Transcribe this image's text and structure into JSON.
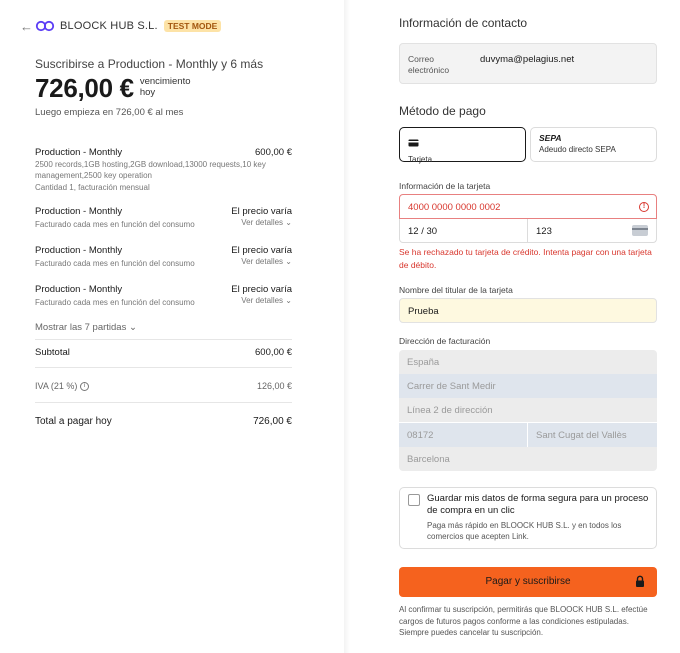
{
  "header": {
    "brand": "BLOOCK HUB S.L.",
    "badge": "TEST MODE"
  },
  "summary": {
    "subscribe_title": "Suscribirse a Production - Monthly y 6 más",
    "price": "726,00 €",
    "price_note_1": "vencimiento",
    "price_note_2": "hoy",
    "after": "Luego empieza en 726,00 € al mes"
  },
  "items": [
    {
      "name": "Production - Monthly",
      "amount": "600,00 €",
      "desc": "2500 records,1GB hosting,2GB download,13000 requests,10 key management,2500 key operation",
      "qty": "Cantidad 1, facturación mensual"
    },
    {
      "name": "Production - Monthly",
      "amount": "El precio varía",
      "desc": "Facturado cada mes en función del consumo",
      "details": "Ver detalles"
    },
    {
      "name": "Production - Monthly",
      "amount": "El precio varía",
      "desc": "Facturado cada mes en función del consumo",
      "details": "Ver detalles"
    },
    {
      "name": "Production - Monthly",
      "amount": "El precio varía",
      "desc": "Facturado cada mes en función del consumo",
      "details": "Ver detalles"
    }
  ],
  "show_more": "Mostrar las 7 partidas",
  "totals": {
    "subtotal_label": "Subtotal",
    "subtotal_value": "600,00 €",
    "tax_label": "IVA (21 %)",
    "tax_value": "126,00 €",
    "total_label": "Total a pagar hoy",
    "total_value": "726,00 €"
  },
  "contact": {
    "title": "Información de contacto",
    "email_label": "Correo electrónico",
    "email_value": "duvyma@pelagius.net"
  },
  "payment": {
    "title": "Método de pago",
    "tab_card": "Tarjeta",
    "tab_sepa_brand": "SEPA",
    "tab_sepa": "Adeudo directo SEPA",
    "card_info_label": "Información de la tarjeta",
    "card_number": "4000 0000 0000 0002",
    "expiry": "12 / 30",
    "cvc": "123",
    "error": "Se ha rechazado tu tarjeta de crédito. Intenta pagar con una tarjeta de débito.",
    "holder_label": "Nombre del titular de la tarjeta",
    "holder_value": "Prueba"
  },
  "billing": {
    "title": "Dirección de facturación",
    "country": "España",
    "line1": "Carrer de Sant Medir",
    "line2_placeholder": "Línea 2 de dirección",
    "postal": "08172",
    "city": "Sant Cugat del Vallès",
    "province": "Barcelona"
  },
  "save": {
    "title": "Guardar mis datos de forma segura para un proceso de compra en un clic",
    "desc": "Paga más rápido en BLOOCK HUB S.L. y en todos los comercios que acepten Link."
  },
  "pay_button": "Pagar y suscribirse",
  "disclaimer": "Al confirmar tu suscripción, permitirás que BLOOCK HUB S.L. efectúe cargos de futuros pagos conforme a las condiciones estipuladas. Siempre puedes cancelar tu suscripción.",
  "colors": {
    "accent": "#f5621e",
    "error": "#d8372e",
    "badge_bg": "#fde3a7",
    "badge_text": "#a2560e",
    "logo": "#5b3df5"
  }
}
